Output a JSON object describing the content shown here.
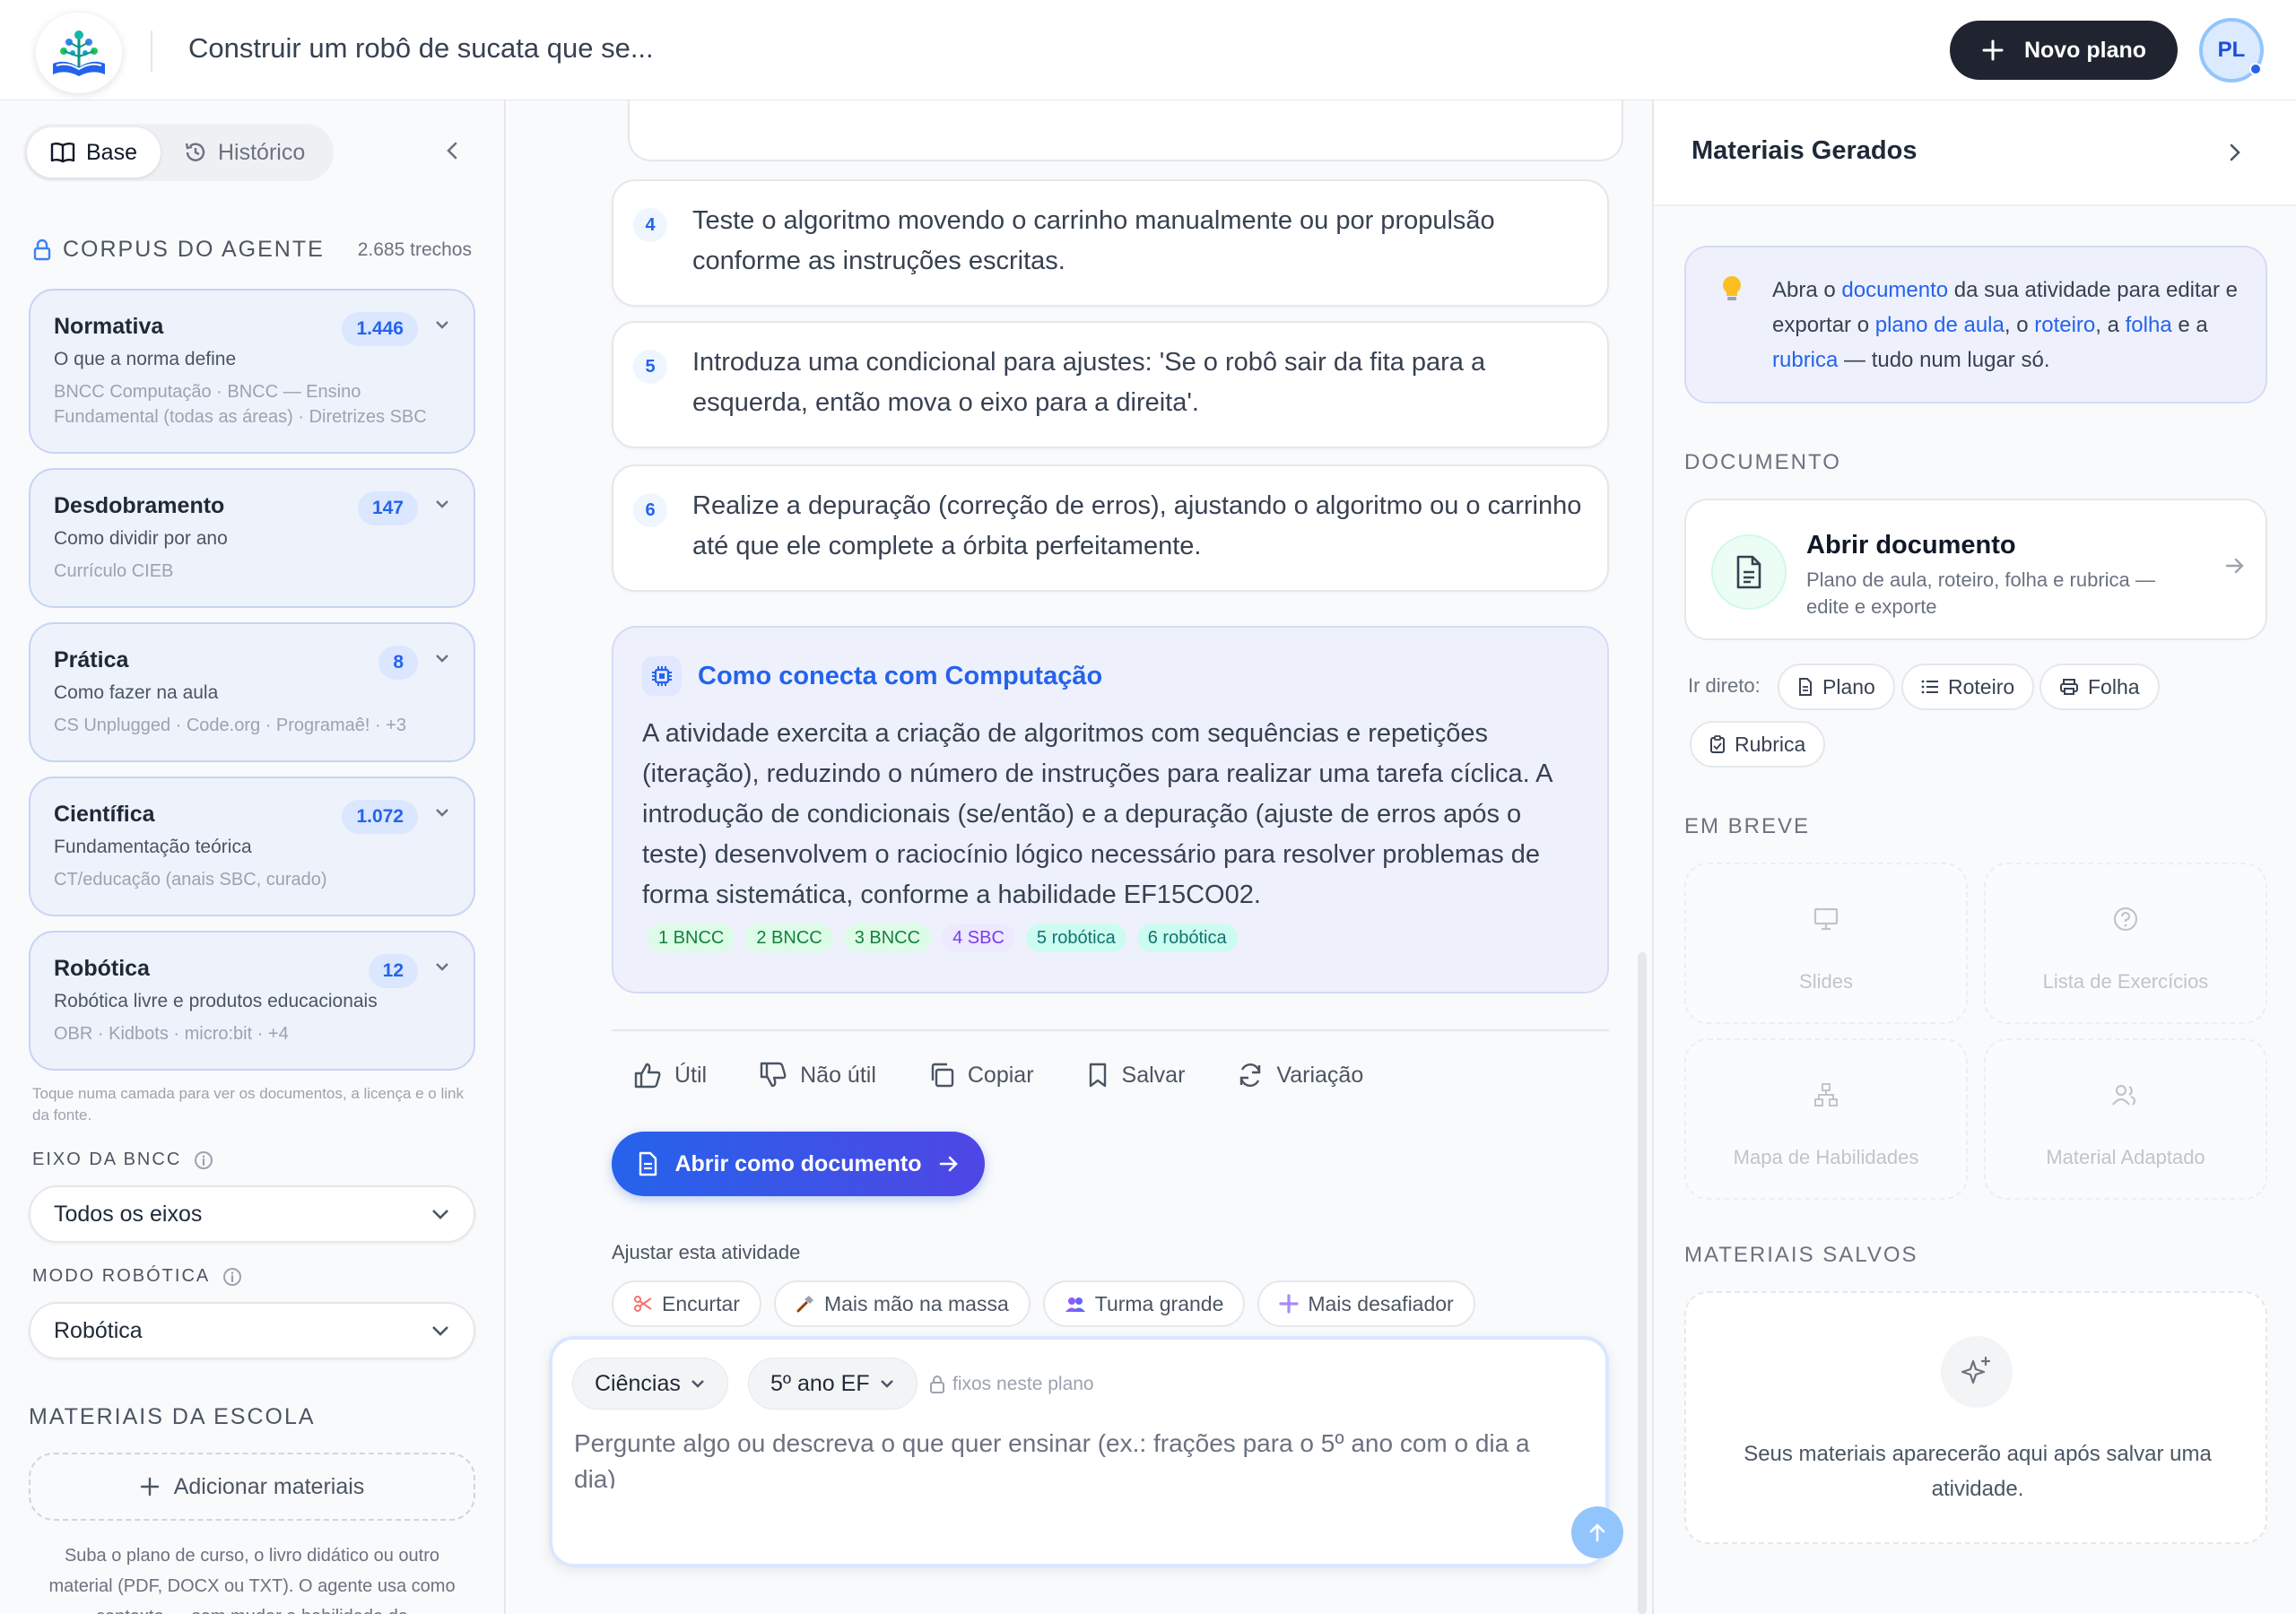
{
  "header": {
    "title": "Construir um robô de sucata que se...",
    "new_plan_label": "Novo plano",
    "avatar_initials": "PL"
  },
  "sidebar": {
    "tabs": [
      {
        "label": "Base",
        "icon": "book-icon",
        "active": true
      },
      {
        "label": "Histórico",
        "icon": "history-icon",
        "active": false
      }
    ],
    "corpus": {
      "title": "CORPUS DO AGENTE",
      "count": "2.685 trechos",
      "layers": [
        {
          "title": "Normativa",
          "count": "1.446",
          "subtitle": "O que a norma define",
          "sources": "BNCC Computação · BNCC — Ensino Fundamental (todas as áreas) · Diretrizes SBC"
        },
        {
          "title": "Desdobramento",
          "count": "147",
          "subtitle": "Como dividir por ano",
          "sources": "Currículo CIEB"
        },
        {
          "title": "Prática",
          "count": "8",
          "subtitle": "Como fazer na aula",
          "sources": "CS Unplugged · Code.org · Programaê! · +3"
        },
        {
          "title": "Científica",
          "count": "1.072",
          "subtitle": "Fundamentação teórica",
          "sources": "CT/educação (anais SBC, curado)"
        },
        {
          "title": "Robótica",
          "count": "12",
          "subtitle": "Robótica livre e produtos educacionais",
          "sources": "OBR · Kidbots · micro:bit · +4"
        }
      ],
      "hint": "Toque numa camada para ver os documentos, a licença e o link da fonte."
    },
    "axis": {
      "label": "EIXO DA BNCC",
      "value": "Todos os eixos"
    },
    "robotics_mode": {
      "label": "MODO ROBÓTICA",
      "value": "Robótica"
    },
    "school": {
      "title": "MATERIAIS DA ESCOLA",
      "add_label": "Adicionar materiais",
      "description": "Suba o plano de curso, o livro didático ou outro material (PDF, DOCX ou TXT). O agente usa como contexto — sem mudar a habilidade da"
    }
  },
  "main": {
    "steps": [
      {
        "num": "4",
        "text": "Teste o algoritmo movendo o carrinho manualmente ou por propulsão conforme as instruções escritas."
      },
      {
        "num": "5",
        "text": "Introduza uma condicional para ajustes: 'Se o robô sair da fita para a esquerda, então mova o eixo para a direita'."
      },
      {
        "num": "6",
        "text": "Realize a depuração (correção de erros), ajustando o algoritmo ou o carrinho até que ele complete a órbita perfeitamente."
      }
    ],
    "computation": {
      "title": "Como conecta com Computação",
      "body": "A atividade exercita a criação de algoritmos com sequências e repetições (iteração), reduzindo o número de instruções para realizar uma tarefa cíclica. A introdução de condicionais (se/então) e a depuração (ajuste de erros após o teste) desenvolvem o raciocínio lógico necessário para resolver problemas de forma sistemática, conforme a habilidade EF15CO02.",
      "tags": [
        {
          "label": "1 BNCC",
          "color": "green"
        },
        {
          "label": "2 BNCC",
          "color": "green"
        },
        {
          "label": "3 BNCC",
          "color": "green"
        },
        {
          "label": "4 SBC",
          "color": "purple"
        },
        {
          "label": "5 robótica",
          "color": "teal"
        },
        {
          "label": "6 robótica",
          "color": "teal"
        }
      ]
    },
    "feedback": [
      {
        "label": "Útil",
        "icon": "thumbs-up-icon"
      },
      {
        "label": "Não útil",
        "icon": "thumbs-down-icon"
      },
      {
        "label": "Copiar",
        "icon": "copy-icon"
      },
      {
        "label": "Salvar",
        "icon": "bookmark-icon"
      },
      {
        "label": "Variação",
        "icon": "refresh-icon"
      }
    ],
    "open_doc_label": "Abrir como documento",
    "adjust": {
      "title": "Ajustar esta atividade",
      "chips": [
        {
          "label": "Encurtar",
          "icon": "scissors-icon"
        },
        {
          "label": "Mais mão na massa",
          "icon": "hammer-icon"
        },
        {
          "label": "Turma grande",
          "icon": "people-icon"
        },
        {
          "label": "Mais desafiador",
          "icon": "plus-icon"
        }
      ]
    },
    "composer": {
      "subject": "Ciências",
      "grade": "5º ano EF",
      "fixed_note": "fixos neste plano",
      "placeholder": "Pergunte algo ou descreva o que quer ensinar (ex.: frações para o 5º ano com o dia a dia)"
    }
  },
  "right": {
    "title": "Materiais Gerados",
    "tip": {
      "p1": "Abra o ",
      "l1": "documento",
      "p2": " da sua atividade para editar e exportar o ",
      "l2": "plano de aula",
      "p3": ", o ",
      "l3": "roteiro",
      "p4": ", a ",
      "l4": "folha",
      "p5": " e a ",
      "l5": "rubrica",
      "p6": " — tudo num lugar só."
    },
    "document": {
      "section": "DOCUMENTO",
      "title": "Abrir documento",
      "subtitle": "Plano de aula, roteiro, folha e rubrica — edite e exporte",
      "direct_label": "Ir direto:",
      "chips": [
        {
          "label": "Plano",
          "icon": "file-icon"
        },
        {
          "label": "Roteiro",
          "icon": "list-icon"
        },
        {
          "label": "Folha",
          "icon": "printer-icon"
        },
        {
          "label": "Rubrica",
          "icon": "clipboard-icon"
        }
      ]
    },
    "soon": {
      "section": "EM BREVE",
      "items": [
        {
          "label": "Slides",
          "icon": "presentation-icon"
        },
        {
          "label": "Lista de Exercícios",
          "icon": "question-circle-icon"
        },
        {
          "label": "Mapa de Habilidades",
          "icon": "hierarchy-icon"
        },
        {
          "label": "Material Adaptado",
          "icon": "users-icon"
        }
      ]
    },
    "saved": {
      "section": "MATERIAIS SALVOS",
      "empty_text": "Seus materiais aparecerão aqui após salvar uma atividade."
    }
  }
}
